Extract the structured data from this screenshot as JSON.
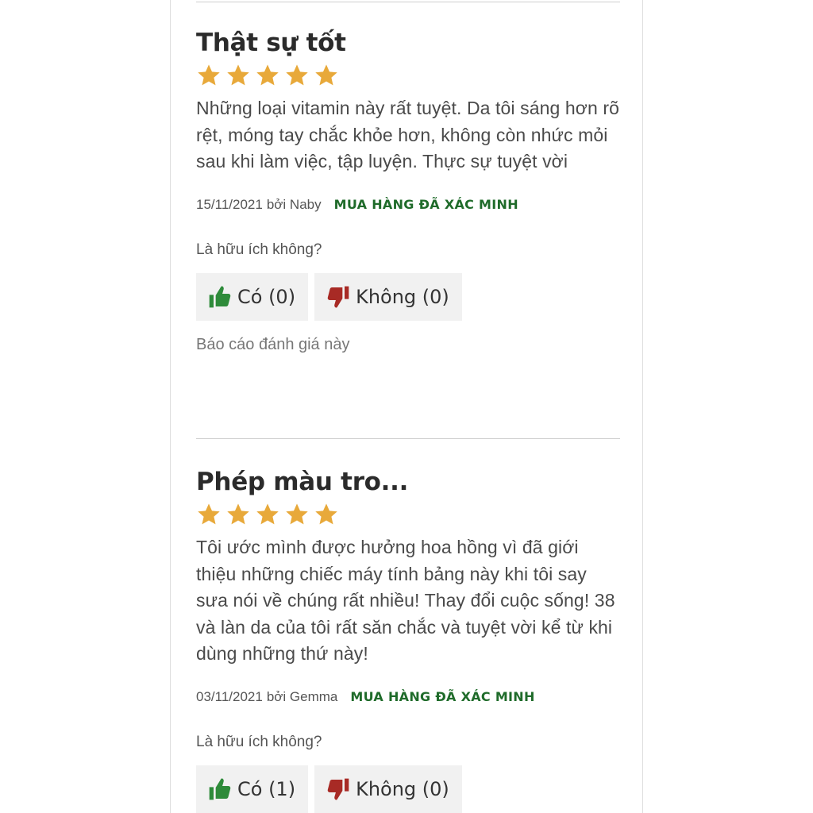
{
  "reviews": [
    {
      "title": "Thật sự tốt",
      "rating": 5,
      "body": "Những loại vitamin này rất tuyệt. Da tôi sáng hơn rõ rệt, móng tay chắc khỏe hơn, không còn nhức mỏi sau khi làm việc, tập luyện. Thực sự tuyệt vời",
      "date": "15/11/2021",
      "by": "bởi Naby",
      "verified": "MUA HÀNG ĐÃ XÁC MINH",
      "helpful_question": "Là hữu ích không?",
      "yes_label": "Có (0)",
      "no_label": "Không (0)",
      "report_label": "Báo cáo đánh giá này"
    },
    {
      "title": "Phép màu tro...",
      "rating": 5,
      "body": "Tôi ước mình được hưởng hoa hồng vì đã giới thiệu những chiếc máy tính bảng này khi tôi say sưa nói về chúng rất nhiều! Thay đổi cuộc sống! 38 và làn da của tôi rất săn chắc và tuyệt vời kể từ khi dùng những thứ này!",
      "date": "03/11/2021",
      "by": "bởi Gemma",
      "verified": "MUA HÀNG ĐÃ XÁC MINH",
      "helpful_question": "Là hữu ích không?",
      "yes_label": "Có (1)",
      "no_label": "Không (0)"
    }
  ],
  "icons": {
    "star": "star-icon",
    "thumbs_up": "thumbs-up-icon",
    "thumbs_down": "thumbs-down-icon"
  },
  "colors": {
    "star": "#e8a93a",
    "verified": "#1f6b2a",
    "thumbs_up": "#2e8b3a",
    "thumbs_down": "#a82a25",
    "button_bg": "#f1f1f1"
  }
}
